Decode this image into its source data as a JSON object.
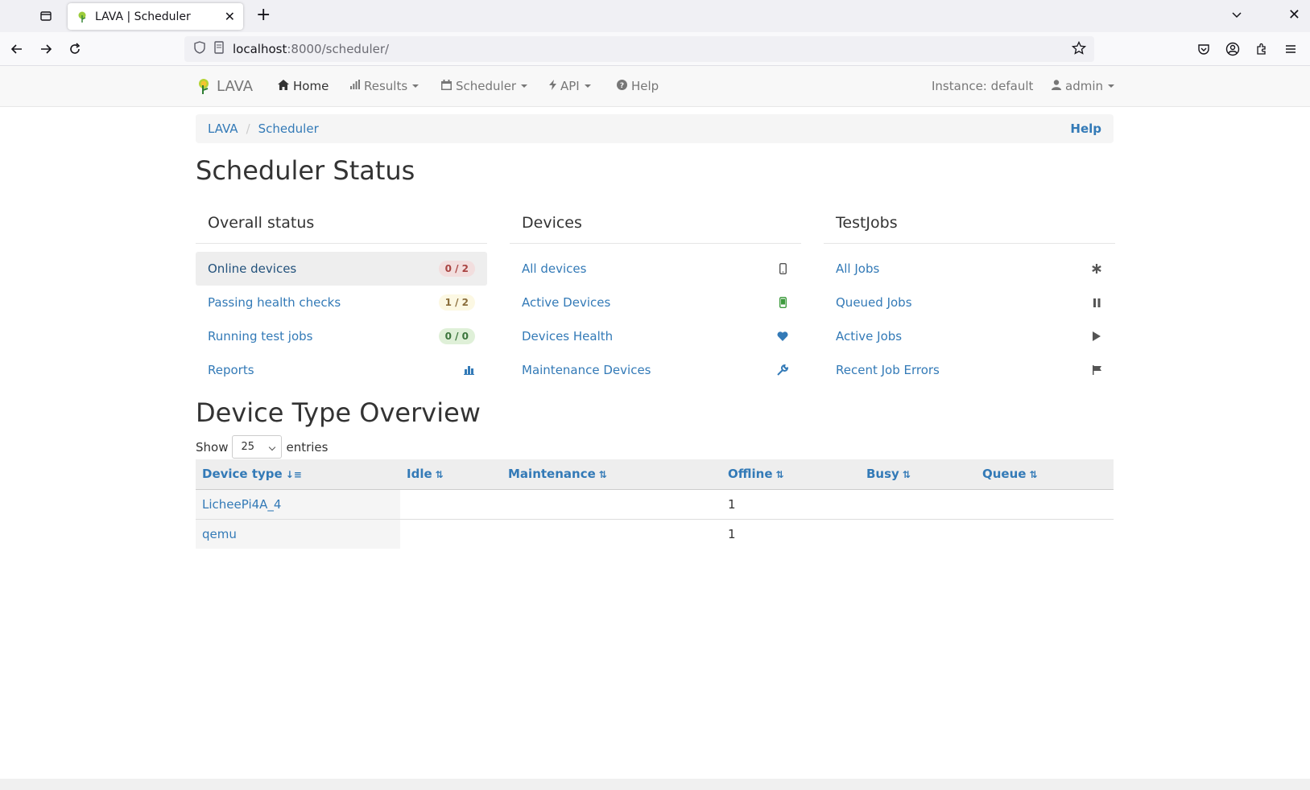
{
  "browser": {
    "tab_title": "LAVA | Scheduler",
    "url_host": "localhost",
    "url_path": ":8000/scheduler/"
  },
  "appnav": {
    "brand": "LAVA",
    "home": "Home",
    "results": "Results",
    "scheduler": "Scheduler",
    "api": "API",
    "help": "Help",
    "instance": "Instance: default",
    "user": "admin"
  },
  "breadcrumb": {
    "items": [
      "LAVA",
      "Scheduler"
    ],
    "help": "Help"
  },
  "page_title": "Scheduler Status",
  "panels": {
    "overall": {
      "title": "Overall status",
      "items": [
        {
          "label": "Online devices",
          "badge": "0 / 2"
        },
        {
          "label": "Passing health checks",
          "badge": "1 / 2"
        },
        {
          "label": "Running test jobs",
          "badge": "0 / 0"
        },
        {
          "label": "Reports",
          "icon": "bar-chart-icon"
        }
      ]
    },
    "devices": {
      "title": "Devices",
      "items": [
        {
          "label": "All devices",
          "icon": "phone-icon"
        },
        {
          "label": "Active Devices",
          "icon": "phone-active-icon"
        },
        {
          "label": "Devices Health",
          "icon": "heart-icon"
        },
        {
          "label": "Maintenance Devices",
          "icon": "wrench-icon"
        }
      ]
    },
    "testjobs": {
      "title": "TestJobs",
      "items": [
        {
          "label": "All Jobs",
          "icon": "asterisk-icon"
        },
        {
          "label": "Queued Jobs",
          "icon": "pause-icon"
        },
        {
          "label": "Active Jobs",
          "icon": "play-icon"
        },
        {
          "label": "Recent Job Errors",
          "icon": "flag-icon"
        }
      ]
    }
  },
  "overview": {
    "title": "Device Type Overview",
    "show_label": "Show",
    "entries_label": "entries",
    "page_size": "25",
    "columns": [
      "Device type",
      "Idle",
      "Maintenance",
      "Offline",
      "Busy",
      "Queue"
    ],
    "rows": [
      {
        "device_type": "LicheePi4A_4",
        "idle": "",
        "maintenance": "",
        "offline": "1",
        "busy": "",
        "queue": ""
      },
      {
        "device_type": "qemu",
        "idle": "",
        "maintenance": "",
        "offline": "1",
        "busy": "",
        "queue": ""
      }
    ]
  }
}
